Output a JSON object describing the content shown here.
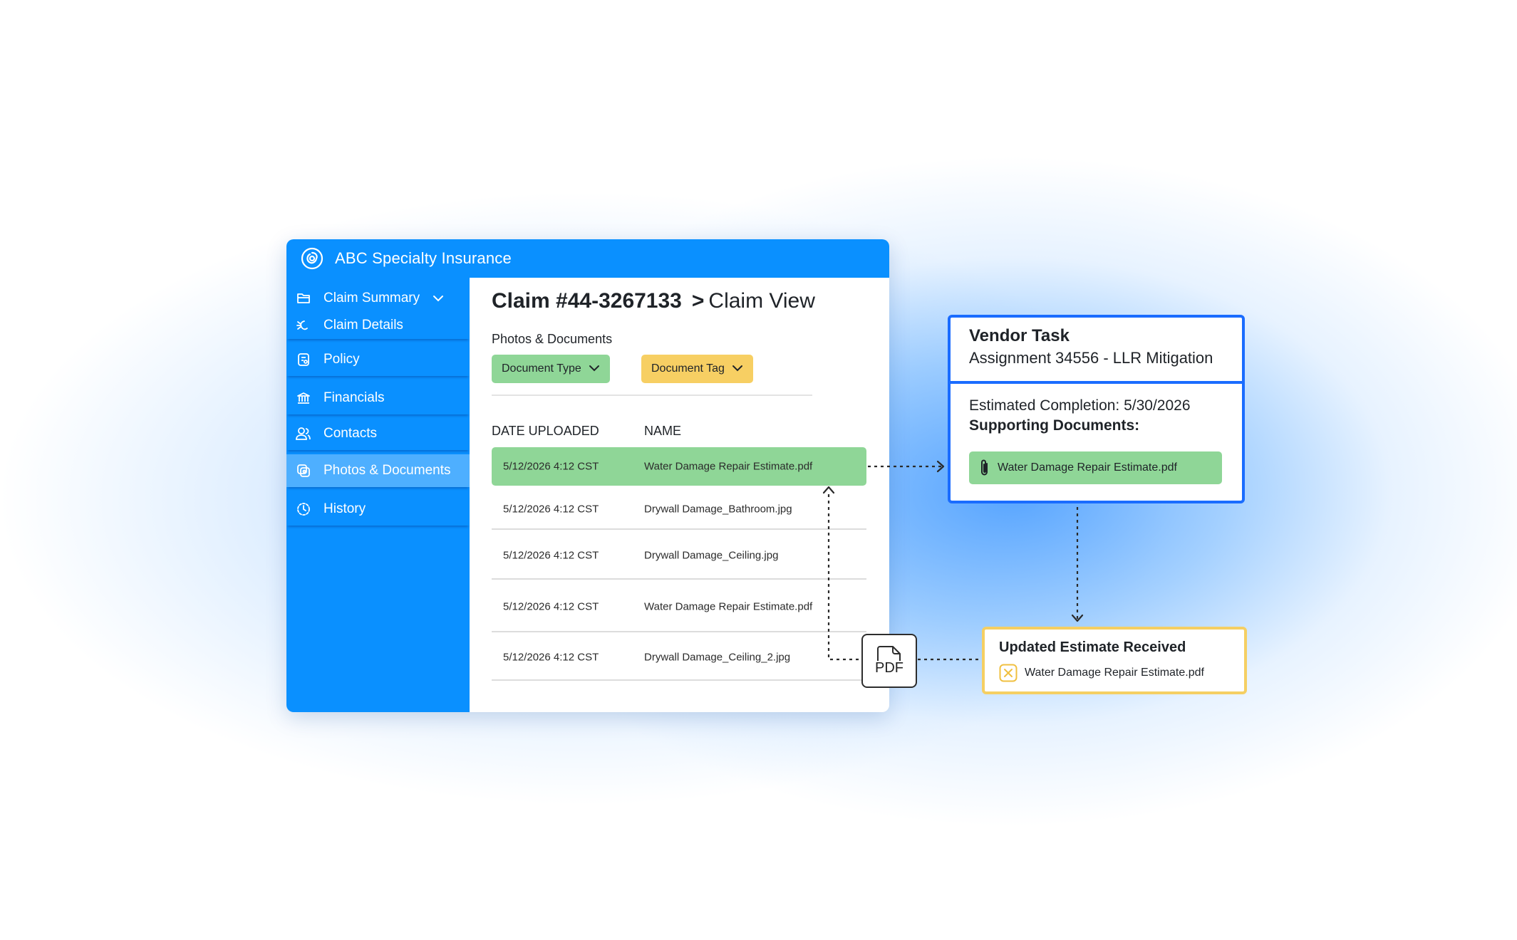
{
  "app": {
    "title": "ABC Specialty Insurance",
    "accent_color": "#0a90ff"
  },
  "sidebar": {
    "items": [
      {
        "label": "Claim Summary",
        "icon": "folder-icon"
      },
      {
        "label": "Claim Details",
        "icon": "sparkle-icon"
      },
      {
        "label": "Policy",
        "icon": "document-icon"
      },
      {
        "label": "Financials",
        "icon": "bank-icon"
      },
      {
        "label": "Contacts",
        "icon": "users-icon"
      },
      {
        "label": "Photos & Documents",
        "icon": "photos-icon",
        "active": true
      },
      {
        "label": "History",
        "icon": "clock-icon"
      }
    ]
  },
  "main": {
    "claim_number": "Claim #44-3267133",
    "separator": ">",
    "view_label": "Claim View",
    "section_label": "Photos & Documents",
    "filters": {
      "document_type": "Document Type",
      "document_tag": "Document Tag"
    },
    "columns": {
      "date": "DATE UPLOADED",
      "name": "NAME"
    },
    "rows": [
      {
        "date": "5/12/2026 4:12 CST",
        "name": "Water Damage Repair Estimate.pdf",
        "highlighted": true
      },
      {
        "date": "5/12/2026 4:12 CST",
        "name": "Drywall Damage_Bathroom.jpg"
      },
      {
        "date": "5/12/2026 4:12 CST",
        "name": "Drywall Damage_Ceiling.jpg"
      },
      {
        "date": "5/12/2026 4:12 CST",
        "name": "Water Damage Repair Estimate.pdf"
      },
      {
        "date": "5/12/2026 4:12 CST",
        "name": "Drywall Damage_Ceiling_2.jpg"
      }
    ]
  },
  "pdf_badge": {
    "label": "PDF"
  },
  "vendor_task": {
    "title": "Vendor Task",
    "assignment": "Assignment 34556 - LLR Mitigation",
    "estimated_completion": "Estimated Completion: 5/30/2026",
    "supporting_label": "Supporting Documents:",
    "attachment": "Water Damage Repair Estimate.pdf",
    "border_color": "#1a6cff"
  },
  "update_card": {
    "title": "Updated Estimate Received",
    "file": "Water Damage Repair Estimate.pdf",
    "border_color": "#f5cf63"
  },
  "colors": {
    "highlight_green": "#8fd697",
    "tag_yellow": "#f7cf63"
  }
}
